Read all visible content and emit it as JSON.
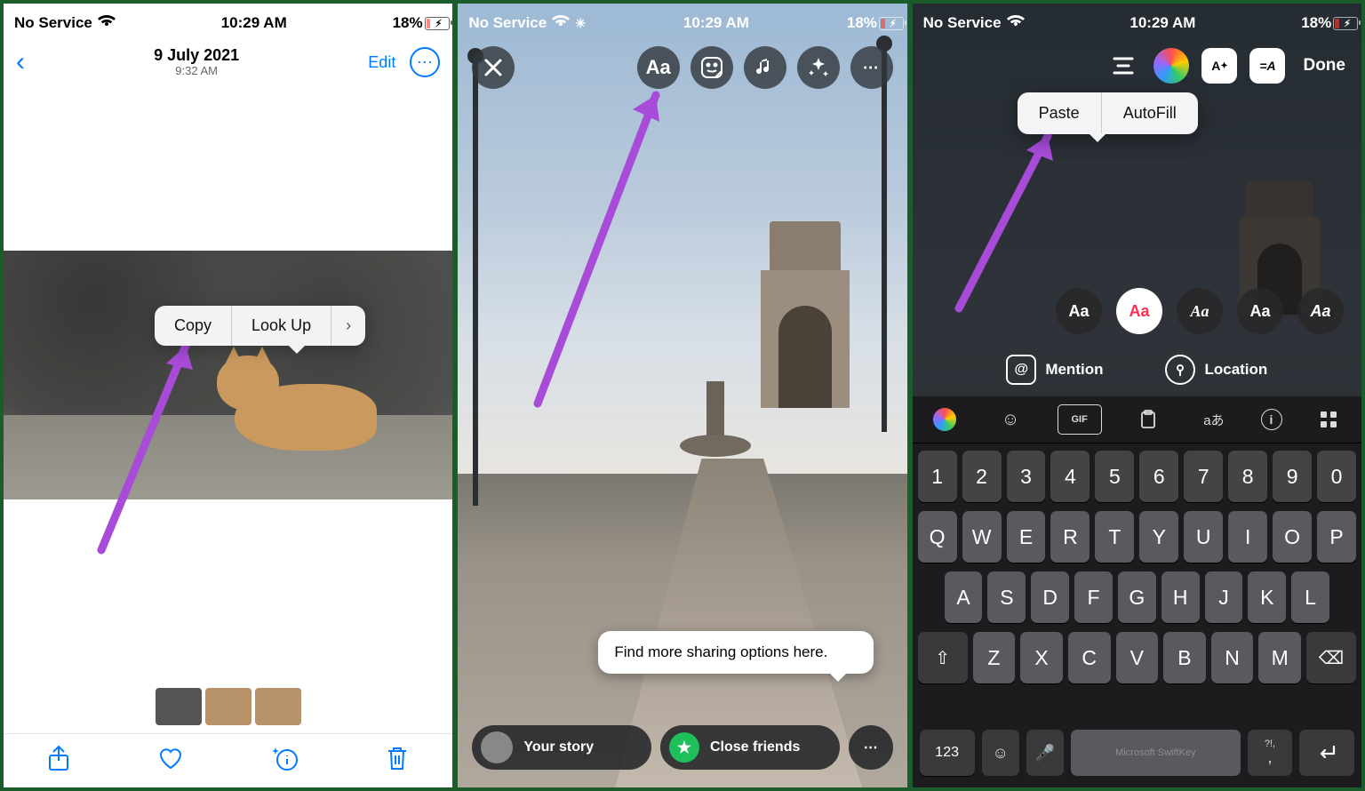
{
  "status": {
    "carrier": "No Service",
    "time": "10:29 AM",
    "battery": "18%"
  },
  "shot1": {
    "title": "9 July 2021",
    "subtitle": "9:32 AM",
    "edit": "Edit",
    "popover": {
      "copy": "Copy",
      "lookup": "Look Up",
      "more": "›"
    },
    "toolbar_icons": [
      "share-icon",
      "heart-icon",
      "info-sparkle-icon",
      "trash-icon"
    ]
  },
  "shot2": {
    "tool_names": [
      "text-Aa",
      "sticker",
      "music",
      "sparkle",
      "more"
    ],
    "tooltip": "Find more sharing options here.",
    "your_story": "Your story",
    "close_friends": "Close friends"
  },
  "shot3": {
    "done": "Done",
    "popover": {
      "paste": "Paste",
      "autofill": "AutoFill"
    },
    "font_chips": [
      "Aa",
      "Aa",
      "Aa",
      "Aa",
      "Aa"
    ],
    "mention": "Mention",
    "location": "Location",
    "keyboard": {
      "row_num": [
        "1",
        "2",
        "3",
        "4",
        "5",
        "6",
        "7",
        "8",
        "9",
        "0"
      ],
      "row1": [
        "Q",
        "W",
        "E",
        "R",
        "T",
        "Y",
        "U",
        "I",
        "O",
        "P"
      ],
      "row2": [
        "A",
        "S",
        "D",
        "F",
        "G",
        "H",
        "J",
        "K",
        "L"
      ],
      "row3": [
        "Z",
        "X",
        "C",
        "V",
        "B",
        "N",
        "M"
      ],
      "shift": "⇧",
      "bksp": "⌫",
      "num": "123",
      "emoji": "☺",
      "mic": "🎤",
      "space_brand": "Microsoft SwiftKey",
      "punct_top": "?!,",
      "comma": ",",
      "enter": "↵"
    }
  }
}
